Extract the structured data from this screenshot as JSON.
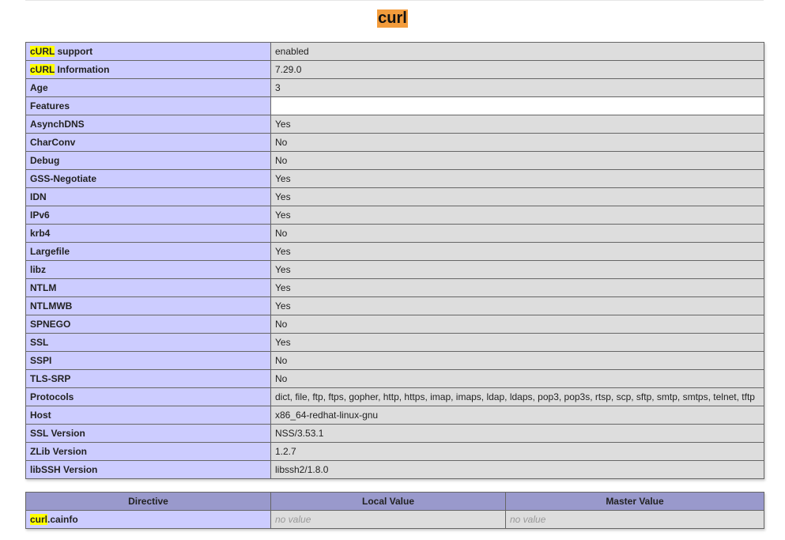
{
  "module": {
    "title": "curl"
  },
  "support_rows": [
    {
      "highlight": "cURL",
      "label": " support",
      "value": "enabled"
    },
    {
      "highlight": "cURL",
      "label": " Information",
      "value": "7.29.0"
    },
    {
      "highlight": "",
      "label": "Age",
      "value": "3"
    },
    {
      "highlight": "",
      "label": "Features",
      "value": ""
    },
    {
      "highlight": "",
      "label": "AsynchDNS",
      "value": "Yes"
    },
    {
      "highlight": "",
      "label": "CharConv",
      "value": "No"
    },
    {
      "highlight": "",
      "label": "Debug",
      "value": "No"
    },
    {
      "highlight": "",
      "label": "GSS-Negotiate",
      "value": "Yes"
    },
    {
      "highlight": "",
      "label": "IDN",
      "value": "Yes"
    },
    {
      "highlight": "",
      "label": "IPv6",
      "value": "Yes"
    },
    {
      "highlight": "",
      "label": "krb4",
      "value": "No"
    },
    {
      "highlight": "",
      "label": "Largefile",
      "value": "Yes"
    },
    {
      "highlight": "",
      "label": "libz",
      "value": "Yes"
    },
    {
      "highlight": "",
      "label": "NTLM",
      "value": "Yes"
    },
    {
      "highlight": "",
      "label": "NTLMWB",
      "value": "Yes"
    },
    {
      "highlight": "",
      "label": "SPNEGO",
      "value": "No"
    },
    {
      "highlight": "",
      "label": "SSL",
      "value": "Yes"
    },
    {
      "highlight": "",
      "label": "SSPI",
      "value": "No"
    },
    {
      "highlight": "",
      "label": "TLS-SRP",
      "value": "No"
    },
    {
      "highlight": "",
      "label": "Protocols",
      "value": "dict, file, ftp, ftps, gopher, http, https, imap, imaps, ldap, ldaps, pop3, pop3s, rtsp, scp, sftp, smtp, smtps, telnet, tftp"
    },
    {
      "highlight": "",
      "label": "Host",
      "value": "x86_64-redhat-linux-gnu"
    },
    {
      "highlight": "",
      "label": "SSL Version",
      "value": "NSS/3.53.1"
    },
    {
      "highlight": "",
      "label": "ZLib Version",
      "value": "1.2.7"
    },
    {
      "highlight": "",
      "label": "libSSH Version",
      "value": "libssh2/1.8.0"
    }
  ],
  "directives": {
    "headers": [
      "Directive",
      "Local Value",
      "Master Value"
    ],
    "rows": [
      {
        "highlight": "curl",
        "name": ".cainfo",
        "local": "no value",
        "master": "no value"
      }
    ]
  },
  "colors": {
    "title_highlight": "#f39c3c",
    "search_highlight": "#ffff00",
    "label_cell": "#ccccff",
    "value_cell": "#dddddd",
    "header_cell": "#9999cc",
    "border": "#666666"
  }
}
